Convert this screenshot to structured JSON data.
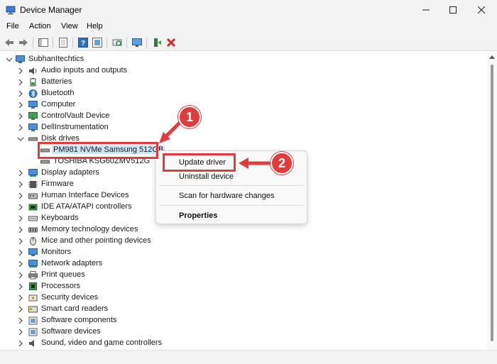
{
  "window": {
    "title": "Device Manager",
    "controls": [
      "minimize",
      "maximize",
      "close"
    ]
  },
  "menubar": {
    "items": [
      "File",
      "Action",
      "View",
      "Help"
    ]
  },
  "toolbar": {
    "buttons": [
      "back-icon",
      "forward-icon",
      "show-hide-tree-icon",
      "properties-icon",
      "help-icon",
      "show-hidden-icon",
      "scan-hardware-icon",
      "monitor-icon",
      "update-driver-icon",
      "uninstall-icon"
    ]
  },
  "tree": {
    "root": "SubhanItechtics",
    "items": [
      {
        "label": "Audio inputs and outputs",
        "icon": "speaker-icon"
      },
      {
        "label": "Batteries",
        "icon": "battery-icon"
      },
      {
        "label": "Bluetooth",
        "icon": "bluetooth-icon"
      },
      {
        "label": "Computer",
        "icon": "computer-icon"
      },
      {
        "label": "ControlVault Device",
        "icon": "controlvault-icon"
      },
      {
        "label": "DellInstrumentation",
        "icon": "monitor-icon"
      },
      {
        "label": "Disk drives",
        "icon": "disk-icon",
        "expanded": true
      },
      {
        "label": "PM981 NVMe Samsung 512GB",
        "icon": "disk-icon",
        "child": true,
        "selected": true
      },
      {
        "label": "TOSHIBA KSG60ZMV512G",
        "icon": "disk-icon",
        "child": true
      },
      {
        "label": "Display adapters",
        "icon": "display-adapter-icon"
      },
      {
        "label": "Firmware",
        "icon": "firmware-icon"
      },
      {
        "label": "Human Interface Devices",
        "icon": "hid-icon"
      },
      {
        "label": "IDE ATA/ATAPI controllers",
        "icon": "ide-icon"
      },
      {
        "label": "Keyboards",
        "icon": "keyboard-icon"
      },
      {
        "label": "Memory technology devices",
        "icon": "memory-icon"
      },
      {
        "label": "Mice and other pointing devices",
        "icon": "mouse-icon"
      },
      {
        "label": "Monitors",
        "icon": "monitor-icon"
      },
      {
        "label": "Network adapters",
        "icon": "network-icon"
      },
      {
        "label": "Print queues",
        "icon": "printer-icon"
      },
      {
        "label": "Processors",
        "icon": "processor-icon"
      },
      {
        "label": "Security devices",
        "icon": "security-icon"
      },
      {
        "label": "Smart card readers",
        "icon": "smartcard-icon"
      },
      {
        "label": "Software components",
        "icon": "software-icon"
      },
      {
        "label": "Software devices",
        "icon": "software-icon"
      },
      {
        "label": "Sound, video and game controllers",
        "icon": "sound-icon"
      }
    ]
  },
  "context_menu": {
    "items": [
      "Update driver",
      "Uninstall device",
      "Scan for hardware changes",
      "Properties"
    ]
  },
  "annotations": {
    "badge_1": "1",
    "badge_2": "2",
    "color": "#e03c3c"
  }
}
